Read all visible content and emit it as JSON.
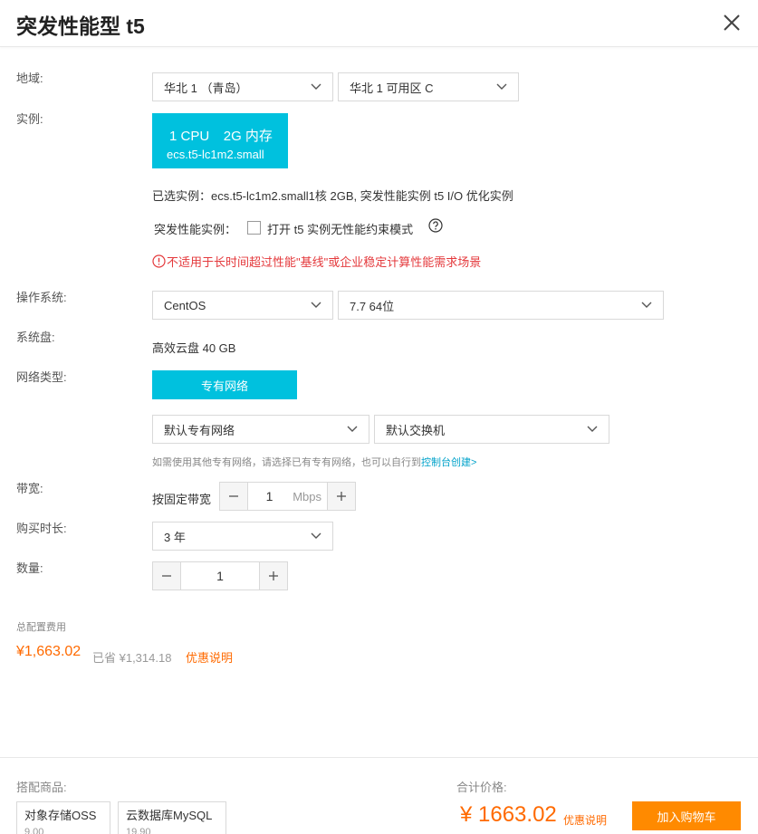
{
  "header": {
    "title": "突发性能型 t5"
  },
  "region": {
    "label": "地域:",
    "region_value": "华北 1 （青岛）",
    "zone_value": "华北 1 可用区 C"
  },
  "instance": {
    "label": "实例:",
    "cpu": "1 CPU",
    "memory": "2G 内存",
    "code": "ecs.t5-lc1m2.small",
    "selected_text": "已选实例：ecs.t5-lc1m2.small1核 2GB, 突发性能实例 t5 I/O 优化实例",
    "burst_label": "突发性能实例：",
    "burst_option": "打开 t5 实例无性能约束模式",
    "warning": "不适用于长时间超过性能\"基线\"或企业稳定计算性能需求场景"
  },
  "os": {
    "label": "操作系统:",
    "os_value": "CentOS",
    "version_value": "7.7 64位"
  },
  "disk": {
    "label": "系统盘:",
    "value": "高效云盘 40 GB"
  },
  "network": {
    "label": "网络类型:",
    "type_button": "专有网络",
    "vpc_value": "默认专有网络",
    "vswitch_value": "默认交换机",
    "hint": "如需使用其他专有网络，请选择已有专有网络，也可以自行到",
    "hint_link": "控制台创建>"
  },
  "bandwidth": {
    "label": "带宽:",
    "mode": "按固定带宽",
    "value": "1",
    "unit": "Mbps"
  },
  "duration": {
    "label": "购买时长:",
    "value": "3 年"
  },
  "quantity": {
    "label": "数量:",
    "value": "1"
  },
  "cost": {
    "label": "总配置费用",
    "price": "¥1,663.02",
    "saved": "已省 ¥1,314.18",
    "discount_link": "优惠说明"
  },
  "footer": {
    "bundle_label": "搭配商品:",
    "products": [
      {
        "name": "对象存储OSS",
        "price": "9.00"
      },
      {
        "name": "云数据库MySQL",
        "price": "19.90"
      }
    ],
    "total_label": "合计价格:",
    "total_price": "¥ 1663.02",
    "discount_link": "优惠说明",
    "cart_button": "加入购物车"
  },
  "colors": {
    "primary": "#00c1de",
    "accent": "#ff6a00",
    "warning": "#e4393c",
    "cart": "#ff8a00"
  }
}
